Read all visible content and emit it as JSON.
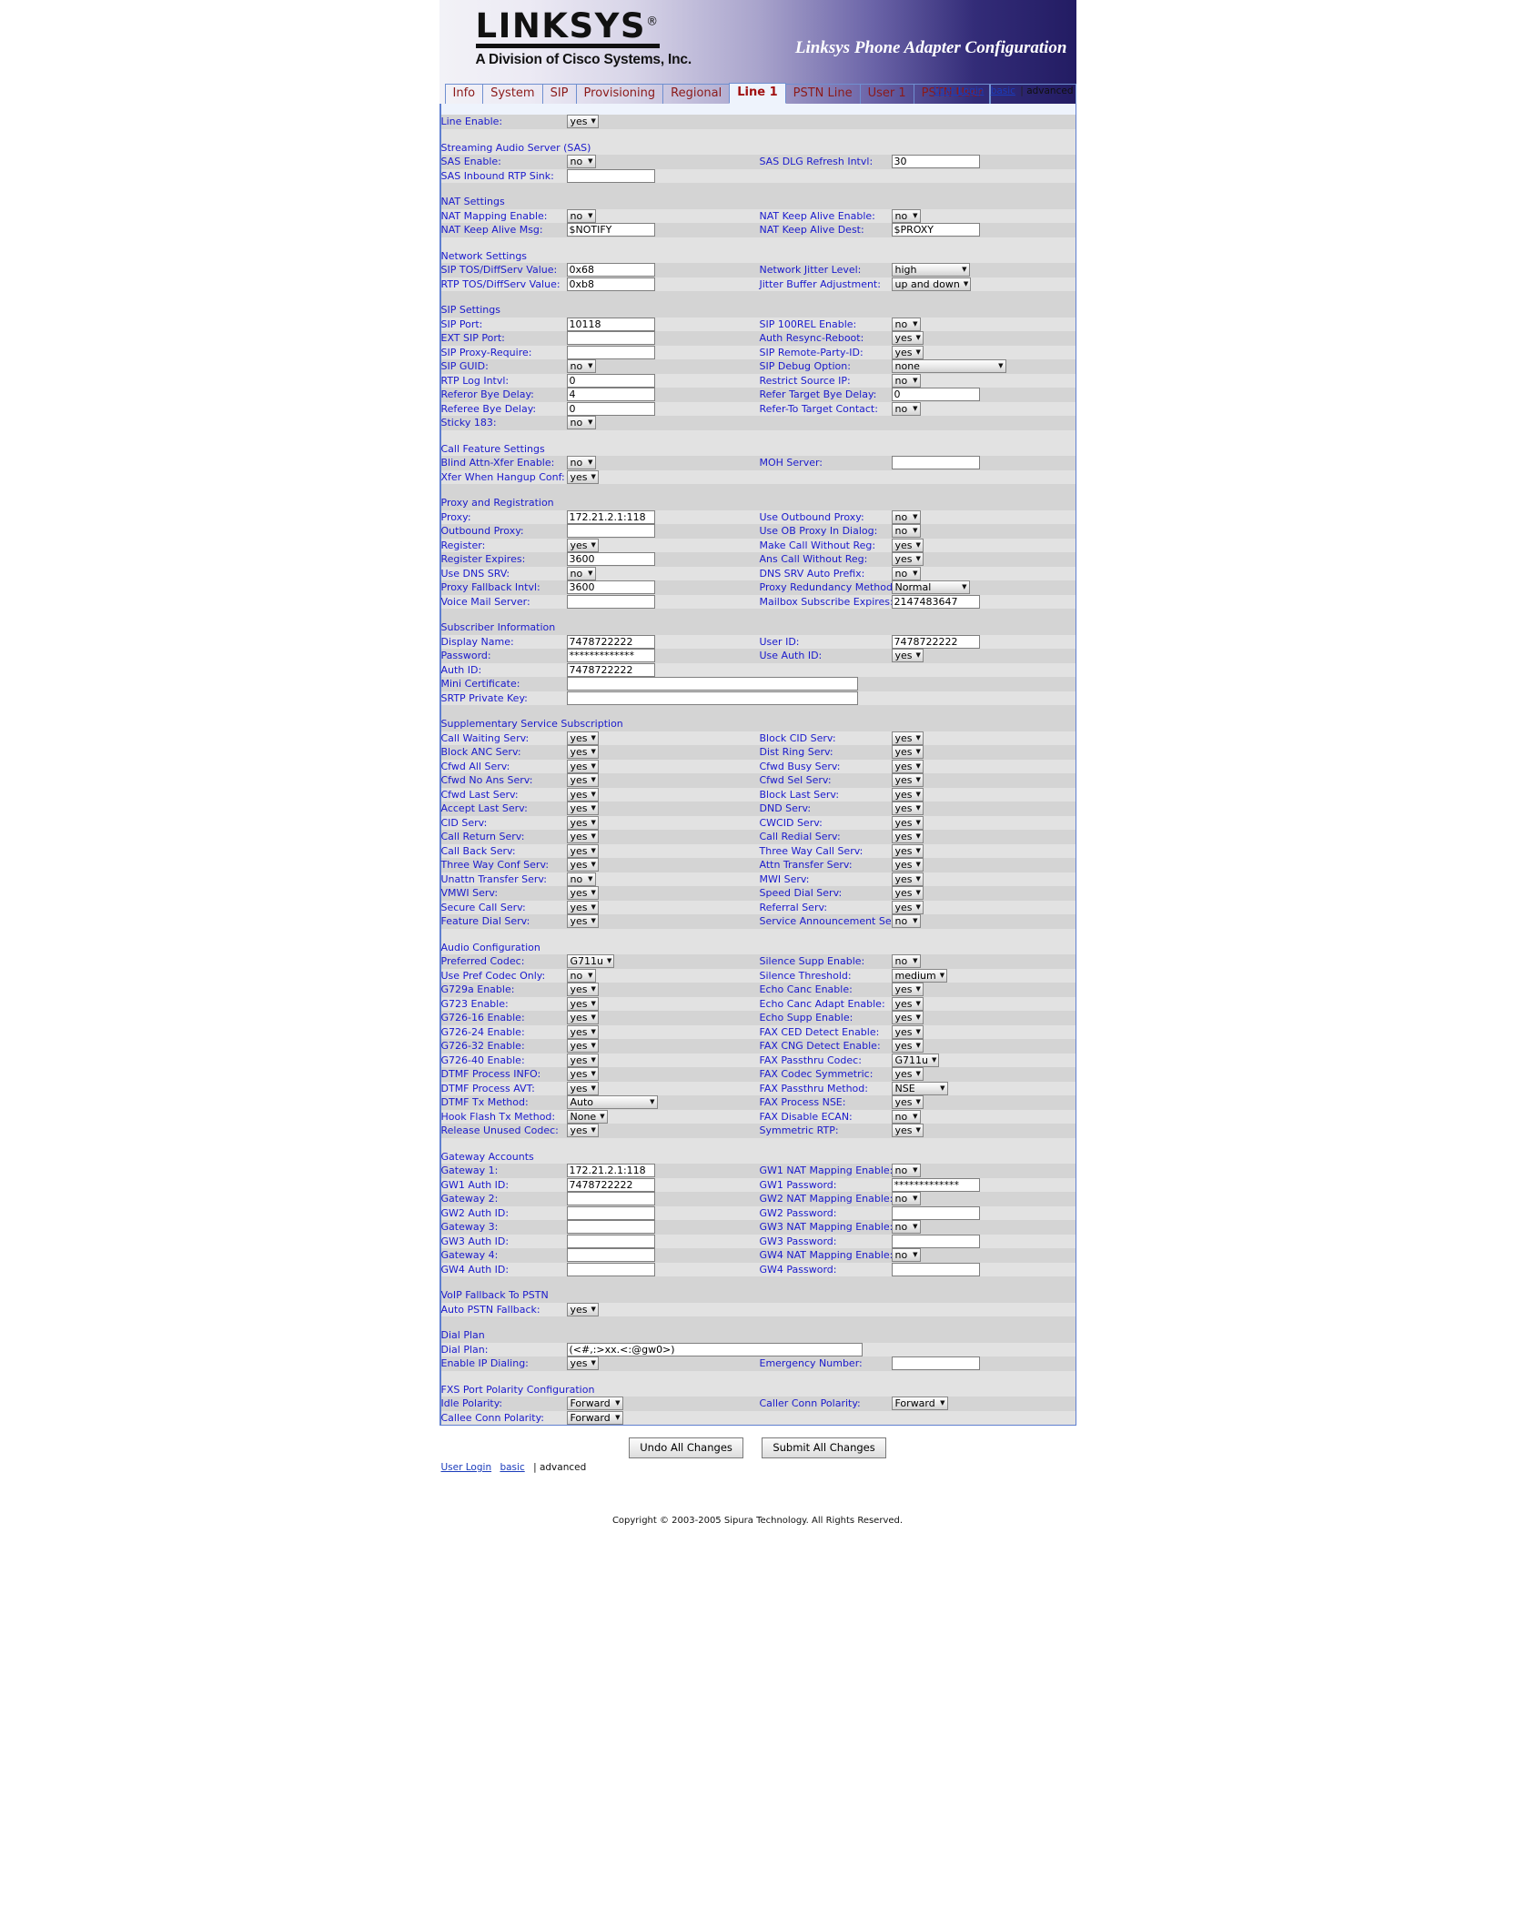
{
  "banner": {
    "logo": "LINKSYS",
    "logo_reg": "®",
    "logo_sub": "A Division of Cisco Systems, Inc.",
    "title": "Linksys Phone Adapter Configuration"
  },
  "tabs": [
    {
      "label": "Info",
      "active": false
    },
    {
      "label": "System",
      "active": false
    },
    {
      "label": "SIP",
      "active": false
    },
    {
      "label": "Provisioning",
      "active": false
    },
    {
      "label": "Regional",
      "active": false
    },
    {
      "label": "Line 1",
      "active": true
    },
    {
      "label": "PSTN Line",
      "active": false
    },
    {
      "label": "User 1",
      "active": false
    },
    {
      "label": "PSTN User",
      "active": false
    }
  ],
  "header_links": {
    "user_login": "User Login",
    "basic": "basic",
    "separator": "|",
    "advanced": "advanced"
  },
  "line_enable": {
    "label": "Line Enable:",
    "value": "yes"
  },
  "sections": [
    {
      "title": "Streaming Audio Server (SAS)",
      "rows": [
        {
          "l1": "SAS Enable:",
          "t1": "select",
          "v1": "no",
          "w1": "w-xs",
          "l2": "SAS DLG Refresh Intvl:",
          "t2": "text",
          "v2": "30",
          "w2": "w-med"
        },
        {
          "l1": "SAS Inbound RTP Sink:",
          "t1": "text",
          "v1": "",
          "w1": "w-med",
          "l2": "",
          "t2": "none",
          "v2": ""
        }
      ]
    },
    {
      "title": "NAT Settings",
      "rows": [
        {
          "l1": "NAT Mapping Enable:",
          "t1": "select",
          "v1": "no",
          "w1": "w-xs",
          "l2": "NAT Keep Alive Enable:",
          "t2": "select",
          "v2": "no",
          "w2": "w-xs"
        },
        {
          "l1": "NAT Keep Alive Msg:",
          "t1": "text",
          "v1": "$NOTIFY",
          "w1": "w-med",
          "l2": "NAT Keep Alive Dest:",
          "t2": "text",
          "v2": "$PROXY",
          "w2": "w-med"
        }
      ]
    },
    {
      "title": "Network Settings",
      "rows": [
        {
          "l1": "SIP TOS/DiffServ Value:",
          "t1": "text",
          "v1": "0x68",
          "w1": "w-med",
          "l2": "Network Jitter Level:",
          "t2": "select",
          "v2": "high",
          "w2": "w-xl"
        },
        {
          "l1": "RTP TOS/DiffServ Value:",
          "t1": "text",
          "v1": "0xb8",
          "w1": "w-med",
          "l2": "Jitter Buffer Adjustment:",
          "t2": "select",
          "v2": "up and down",
          "w2": "w-l"
        }
      ]
    },
    {
      "title": "SIP Settings",
      "rows": [
        {
          "l1": "SIP Port:",
          "t1": "text",
          "v1": "10118",
          "w1": "w-med",
          "l2": "SIP 100REL Enable:",
          "t2": "select",
          "v2": "no",
          "w2": "w-xs"
        },
        {
          "l1": "EXT SIP Port:",
          "t1": "text",
          "v1": "",
          "w1": "w-med",
          "l2": "Auth Resync-Reboot:",
          "t2": "select",
          "v2": "yes",
          "w2": "w-xs"
        },
        {
          "l1": "SIP Proxy-Require:",
          "t1": "text",
          "v1": "",
          "w1": "w-med",
          "l2": "SIP Remote-Party-ID:",
          "t2": "select",
          "v2": "yes",
          "w2": "w-xs"
        },
        {
          "l1": "SIP GUID:",
          "t1": "select",
          "v1": "no",
          "w1": "w-xs",
          "l2": "SIP Debug Option:",
          "t2": "select",
          "v2": "none",
          "w2": "w-xxl"
        },
        {
          "l1": "RTP Log Intvl:",
          "t1": "text",
          "v1": "0",
          "w1": "w-med",
          "l2": "Restrict Source IP:",
          "t2": "select",
          "v2": "no",
          "w2": "w-xs"
        },
        {
          "l1": "Referor Bye Delay:",
          "t1": "text",
          "v1": "4",
          "w1": "w-med",
          "l2": "Refer Target Bye Delay:",
          "t2": "text",
          "v2": "0",
          "w2": "w-med"
        },
        {
          "l1": "Referee Bye Delay:",
          "t1": "text",
          "v1": "0",
          "w1": "w-med",
          "l2": "Refer-To Target Contact:",
          "t2": "select",
          "v2": "no",
          "w2": "w-xs"
        },
        {
          "l1": "Sticky 183:",
          "t1": "select",
          "v1": "no",
          "w1": "w-xs",
          "l2": "",
          "t2": "none",
          "v2": ""
        }
      ]
    },
    {
      "title": "Call Feature Settings",
      "rows": [
        {
          "l1": "Blind Attn-Xfer Enable:",
          "t1": "select",
          "v1": "no",
          "w1": "w-xs",
          "l2": "MOH Server:",
          "t2": "text",
          "v2": "",
          "w2": "w-med"
        },
        {
          "l1": "Xfer When Hangup Conf:",
          "t1": "select",
          "v1": "yes",
          "w1": "w-xs",
          "l2": "",
          "t2": "none",
          "v2": ""
        }
      ]
    },
    {
      "title": "Proxy and Registration",
      "rows": [
        {
          "l1": "Proxy:",
          "t1": "text",
          "v1": "172.21.2.1:118",
          "w1": "w-med",
          "l2": "Use Outbound Proxy:",
          "t2": "select",
          "v2": "no",
          "w2": "w-xs"
        },
        {
          "l1": "Outbound Proxy:",
          "t1": "text",
          "v1": "",
          "w1": "w-med",
          "l2": "Use OB Proxy In Dialog:",
          "t2": "select",
          "v2": "no",
          "w2": "w-xs"
        },
        {
          "l1": "Register:",
          "t1": "select",
          "v1": "yes",
          "w1": "w-xs",
          "l2": "Make Call Without Reg:",
          "t2": "select",
          "v2": "yes",
          "w2": "w-xs"
        },
        {
          "l1": "Register Expires:",
          "t1": "text",
          "v1": "3600",
          "w1": "w-med",
          "l2": "Ans Call Without Reg:",
          "t2": "select",
          "v2": "yes",
          "w2": "w-xs"
        },
        {
          "l1": "Use DNS SRV:",
          "t1": "select",
          "v1": "no",
          "w1": "w-xs",
          "l2": "DNS SRV Auto Prefix:",
          "t2": "select",
          "v2": "no",
          "w2": "w-xs"
        },
        {
          "l1": "Proxy Fallback Intvl:",
          "t1": "text",
          "v1": "3600",
          "w1": "w-med",
          "l2": "Proxy Redundancy Method:",
          "t2": "select",
          "v2": "Normal",
          "w2": "w-xl"
        },
        {
          "l1": "Voice Mail Server:",
          "t1": "text",
          "v1": "",
          "w1": "w-med",
          "l2": "Mailbox Subscribe Expires:",
          "t2": "text",
          "v2": "2147483647",
          "w2": "w-med"
        }
      ]
    },
    {
      "title": "Subscriber Information",
      "rows": [
        {
          "l1": "Display Name:",
          "t1": "text",
          "v1": "7478722222",
          "w1": "w-med",
          "l2": "User ID:",
          "t2": "text",
          "v2": "7478722222",
          "w2": "w-med"
        },
        {
          "l1": "Password:",
          "t1": "text",
          "v1": "*************",
          "w1": "w-med",
          "l2": "Use Auth ID:",
          "t2": "select",
          "v2": "yes",
          "w2": "w-xs"
        },
        {
          "l1": "Auth ID:",
          "t1": "text",
          "v1": "7478722222",
          "w1": "w-med",
          "l2": "",
          "t2": "none",
          "v2": ""
        },
        {
          "l1": "Mini Certificate:",
          "t1": "textwide",
          "v1": "",
          "w1": "w-wide",
          "l2": "",
          "t2": "none",
          "v2": ""
        },
        {
          "l1": "SRTP Private Key:",
          "t1": "textwide",
          "v1": "",
          "w1": "w-wide",
          "l2": "",
          "t2": "none",
          "v2": ""
        }
      ]
    },
    {
      "title": "Supplementary Service Subscription",
      "rows": [
        {
          "l1": "Call Waiting Serv:",
          "t1": "select",
          "v1": "yes",
          "w1": "w-xs",
          "l2": "Block CID Serv:",
          "t2": "select",
          "v2": "yes",
          "w2": "w-xs"
        },
        {
          "l1": "Block ANC Serv:",
          "t1": "select",
          "v1": "yes",
          "w1": "w-xs",
          "l2": "Dist Ring Serv:",
          "t2": "select",
          "v2": "yes",
          "w2": "w-xs"
        },
        {
          "l1": "Cfwd All Serv:",
          "t1": "select",
          "v1": "yes",
          "w1": "w-xs",
          "l2": "Cfwd Busy Serv:",
          "t2": "select",
          "v2": "yes",
          "w2": "w-xs"
        },
        {
          "l1": "Cfwd No Ans Serv:",
          "t1": "select",
          "v1": "yes",
          "w1": "w-xs",
          "l2": "Cfwd Sel Serv:",
          "t2": "select",
          "v2": "yes",
          "w2": "w-xs"
        },
        {
          "l1": "Cfwd Last Serv:",
          "t1": "select",
          "v1": "yes",
          "w1": "w-xs",
          "l2": "Block Last Serv:",
          "t2": "select",
          "v2": "yes",
          "w2": "w-xs"
        },
        {
          "l1": "Accept Last Serv:",
          "t1": "select",
          "v1": "yes",
          "w1": "w-xs",
          "l2": "DND Serv:",
          "t2": "select",
          "v2": "yes",
          "w2": "w-xs"
        },
        {
          "l1": "CID Serv:",
          "t1": "select",
          "v1": "yes",
          "w1": "w-xs",
          "l2": "CWCID Serv:",
          "t2": "select",
          "v2": "yes",
          "w2": "w-xs"
        },
        {
          "l1": "Call Return Serv:",
          "t1": "select",
          "v1": "yes",
          "w1": "w-xs",
          "l2": "Call Redial Serv:",
          "t2": "select",
          "v2": "yes",
          "w2": "w-xs"
        },
        {
          "l1": "Call Back Serv:",
          "t1": "select",
          "v1": "yes",
          "w1": "w-xs",
          "l2": "Three Way Call Serv:",
          "t2": "select",
          "v2": "yes",
          "w2": "w-xs"
        },
        {
          "l1": "Three Way Conf Serv:",
          "t1": "select",
          "v1": "yes",
          "w1": "w-xs",
          "l2": "Attn Transfer Serv:",
          "t2": "select",
          "v2": "yes",
          "w2": "w-xs"
        },
        {
          "l1": "Unattn Transfer Serv:",
          "t1": "select",
          "v1": "no",
          "w1": "w-xs",
          "l2": "MWI Serv:",
          "t2": "select",
          "v2": "yes",
          "w2": "w-xs"
        },
        {
          "l1": "VMWI Serv:",
          "t1": "select",
          "v1": "yes",
          "w1": "w-xs",
          "l2": "Speed Dial Serv:",
          "t2": "select",
          "v2": "yes",
          "w2": "w-xs"
        },
        {
          "l1": "Secure Call Serv:",
          "t1": "select",
          "v1": "yes",
          "w1": "w-xs",
          "l2": "Referral Serv:",
          "t2": "select",
          "v2": "yes",
          "w2": "w-xs"
        },
        {
          "l1": "Feature Dial Serv:",
          "t1": "select",
          "v1": "yes",
          "w1": "w-xs",
          "l2": "Service Announcement Serv:",
          "t2": "select",
          "v2": "no",
          "w2": "w-xs"
        }
      ]
    },
    {
      "title": "Audio Configuration",
      "rows": [
        {
          "l1": "Preferred Codec:",
          "t1": "select",
          "v1": "G711u",
          "w1": "w-m",
          "l2": "Silence Supp Enable:",
          "t2": "select",
          "v2": "no",
          "w2": "w-xs"
        },
        {
          "l1": "Use Pref Codec Only:",
          "t1": "select",
          "v1": "no",
          "w1": "w-xs",
          "l2": "Silence Threshold:",
          "t2": "select",
          "v2": "medium",
          "w2": "w-s"
        },
        {
          "l1": "G729a Enable:",
          "t1": "select",
          "v1": "yes",
          "w1": "w-xs",
          "l2": "Echo Canc Enable:",
          "t2": "select",
          "v2": "yes",
          "w2": "w-xs"
        },
        {
          "l1": "G723 Enable:",
          "t1": "select",
          "v1": "yes",
          "w1": "w-xs",
          "l2": "Echo Canc Adapt Enable:",
          "t2": "select",
          "v2": "yes",
          "w2": "w-xs"
        },
        {
          "l1": "G726-16 Enable:",
          "t1": "select",
          "v1": "yes",
          "w1": "w-xs",
          "l2": "Echo Supp Enable:",
          "t2": "select",
          "v2": "yes",
          "w2": "w-xs"
        },
        {
          "l1": "G726-24 Enable:",
          "t1": "select",
          "v1": "yes",
          "w1": "w-xs",
          "l2": "FAX CED Detect Enable:",
          "t2": "select",
          "v2": "yes",
          "w2": "w-xs"
        },
        {
          "l1": "G726-32 Enable:",
          "t1": "select",
          "v1": "yes",
          "w1": "w-xs",
          "l2": "FAX CNG Detect Enable:",
          "t2": "select",
          "v2": "yes",
          "w2": "w-xs"
        },
        {
          "l1": "G726-40 Enable:",
          "t1": "select",
          "v1": "yes",
          "w1": "w-xs",
          "l2": "FAX Passthru Codec:",
          "t2": "select",
          "v2": "G711u",
          "w2": "w-s"
        },
        {
          "l1": "DTMF Process INFO:",
          "t1": "select",
          "v1": "yes",
          "w1": "w-xs",
          "l2": "FAX Codec Symmetric:",
          "t2": "select",
          "v2": "yes",
          "w2": "w-xs"
        },
        {
          "l1": "DTMF Process AVT:",
          "t1": "select",
          "v1": "yes",
          "w1": "w-xs",
          "l2": "FAX Passthru Method:",
          "t2": "select",
          "v2": "NSE",
          "w2": "w-l"
        },
        {
          "l1": "DTMF Tx Method:",
          "t1": "select",
          "v1": "Auto",
          "w1": "w-huge",
          "l2": "FAX Process NSE:",
          "t2": "select",
          "v2": "yes",
          "w2": "w-xs"
        },
        {
          "l1": "Hook Flash Tx Method:",
          "t1": "select",
          "v1": "None",
          "w1": "w-s",
          "l2": "FAX Disable ECAN:",
          "t2": "select",
          "v2": "no",
          "w2": "w-xs"
        },
        {
          "l1": "Release Unused Codec:",
          "t1": "select",
          "v1": "yes",
          "w1": "w-xs",
          "l2": "Symmetric RTP:",
          "t2": "select",
          "v2": "yes",
          "w2": "w-xs"
        }
      ]
    },
    {
      "title": "Gateway Accounts",
      "rows": [
        {
          "l1": "Gateway 1:",
          "t1": "text",
          "v1": "172.21.2.1:118",
          "w1": "w-med",
          "l2": "GW1 NAT Mapping Enable:",
          "t2": "select",
          "v2": "no",
          "w2": "w-xs"
        },
        {
          "l1": "GW1 Auth ID:",
          "t1": "text",
          "v1": "7478722222",
          "w1": "w-med",
          "l2": "GW1 Password:",
          "t2": "text",
          "v2": "*************",
          "w2": "w-med"
        },
        {
          "l1": "Gateway 2:",
          "t1": "text",
          "v1": "",
          "w1": "w-med",
          "l2": "GW2 NAT Mapping Enable:",
          "t2": "select",
          "v2": "no",
          "w2": "w-xs"
        },
        {
          "l1": "GW2 Auth ID:",
          "t1": "text",
          "v1": "",
          "w1": "w-med",
          "l2": "GW2 Password:",
          "t2": "text",
          "v2": "",
          "w2": "w-med"
        },
        {
          "l1": "Gateway 3:",
          "t1": "text",
          "v1": "",
          "w1": "w-med",
          "l2": "GW3 NAT Mapping Enable:",
          "t2": "select",
          "v2": "no",
          "w2": "w-xs"
        },
        {
          "l1": "GW3 Auth ID:",
          "t1": "text",
          "v1": "",
          "w1": "w-med",
          "l2": "GW3 Password:",
          "t2": "text",
          "v2": "",
          "w2": "w-med"
        },
        {
          "l1": "Gateway 4:",
          "t1": "text",
          "v1": "",
          "w1": "w-med",
          "l2": "GW4 NAT Mapping Enable:",
          "t2": "select",
          "v2": "no",
          "w2": "w-xs"
        },
        {
          "l1": "GW4 Auth ID:",
          "t1": "text",
          "v1": "",
          "w1": "w-med",
          "l2": "GW4 Password:",
          "t2": "text",
          "v2": "",
          "w2": "w-med"
        }
      ]
    },
    {
      "title": "VoIP Fallback To PSTN",
      "rows": [
        {
          "l1": "Auto PSTN Fallback:",
          "t1": "select",
          "v1": "yes",
          "w1": "w-xs",
          "l2": "",
          "t2": "none",
          "v2": ""
        }
      ]
    },
    {
      "title": "Dial Plan",
      "rows": [
        {
          "l1": "Dial Plan:",
          "t1": "textwide",
          "v1": "(<#,:>xx.<:@gw0>)",
          "w1": "w-xwide",
          "l2": "",
          "t2": "none",
          "v2": ""
        },
        {
          "l1": "Enable IP Dialing:",
          "t1": "select",
          "v1": "yes",
          "w1": "w-xs",
          "l2": "Emergency Number:",
          "t2": "text",
          "v2": "",
          "w2": "w-med"
        }
      ]
    },
    {
      "title": "FXS Port Polarity Configuration",
      "rows": [
        {
          "l1": "Idle Polarity:",
          "t1": "select",
          "v1": "Forward",
          "w1": "w-l",
          "l2": "Caller Conn Polarity:",
          "t2": "select",
          "v2": "Forward",
          "w2": "w-l"
        },
        {
          "l1": "Callee Conn Polarity:",
          "t1": "select",
          "v1": "Forward",
          "w1": "w-l",
          "l2": "",
          "t2": "none",
          "v2": ""
        }
      ]
    }
  ],
  "footer": {
    "undo_label": "Undo All Changes",
    "submit_label": "Submit All Changes",
    "user_login": "User Login",
    "basic": "basic",
    "separator": "|",
    "advanced": "advanced",
    "copyright": "Copyright © 2003-2005 Sipura Technology. All Rights Reserved."
  },
  "colors": {
    "section_heading": "#b02020",
    "label": "#1a1acc",
    "tab_text": "#8b1a1a",
    "link": "#1a3bbb",
    "row_a": "#d4d4d4",
    "row_b": "#e2e2e2"
  }
}
